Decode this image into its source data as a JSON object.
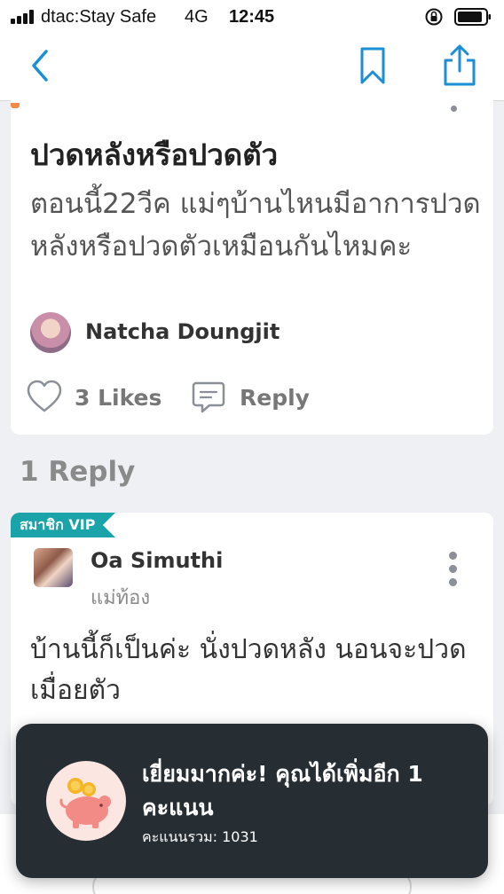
{
  "status_bar": {
    "carrier": "dtac:Stay Safe",
    "network": "4G",
    "time": "12:45"
  },
  "nav": {
    "icons": [
      "back-icon",
      "bookmark-icon",
      "share-icon"
    ]
  },
  "question": {
    "title": "ปวดหลังหรือปวดตัว",
    "body": "ตอนนี้22วีค แม่ๆบ้านไหนมีอาการปวดหลังหรือปวดตัวเหมือนกันไหมคะ",
    "author": "Natcha Doungjit",
    "likes_label": "3 Likes",
    "reply_label": "Reply"
  },
  "reply_count": "1 Reply",
  "reply": {
    "badge": "สมาชิก VIP",
    "author": "Oa Simuthi",
    "status": "แม่ท้อง",
    "body": "บ้านนี้ก็เป็นค่ะ นั่งปวดหลัง นอนจะปวดเมื่อยตัว"
  },
  "toast": {
    "title": "เยี่ยมมากค่ะ! คุณได้เพิ่มอีก 1 คะแนน",
    "subtitle": "คะแนนรวม: 1031",
    "icon": "piggy-bank-coin-icon"
  },
  "colors": {
    "accent": "#1a8fd6",
    "vip": "#1aa3a8",
    "toast_bg": "#262d33",
    "piggy": "#f28b86"
  }
}
